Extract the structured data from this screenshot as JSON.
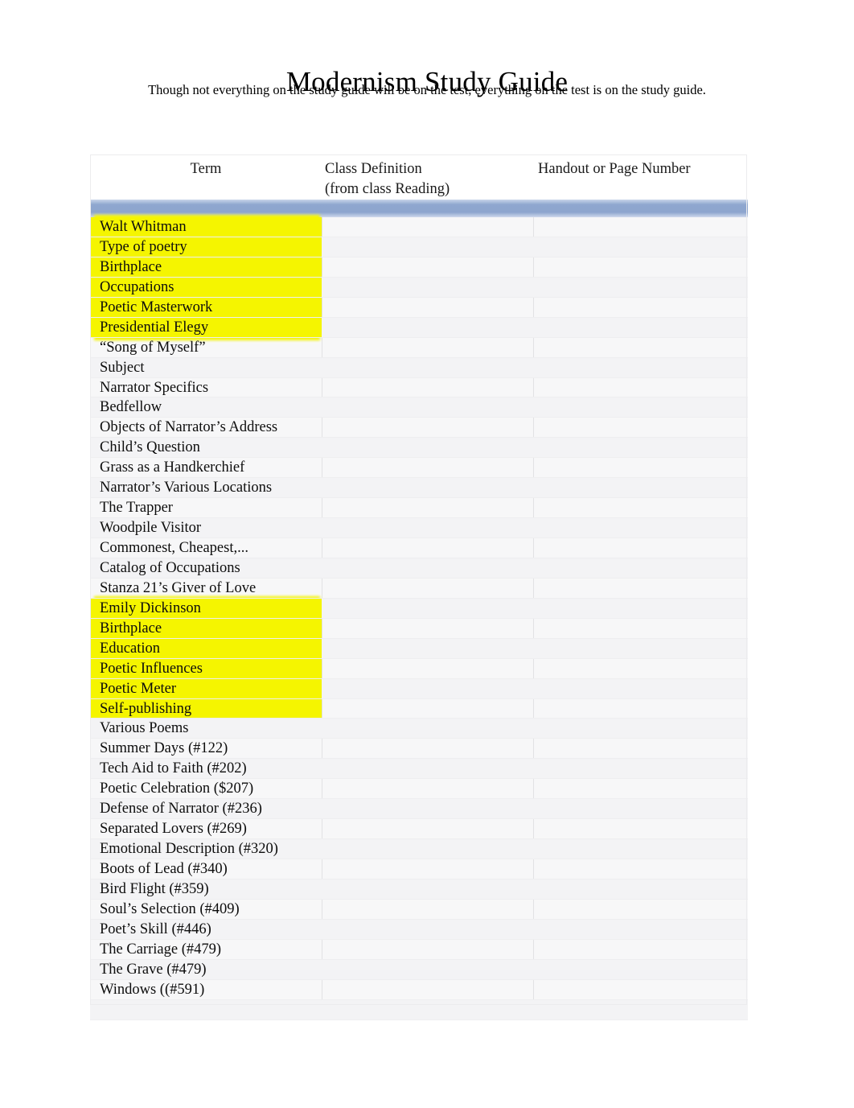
{
  "document": {
    "title": "Modernism Study Guide",
    "subtitle": "Though not everything on the study guide will be on the test, everything on the test is on the study guide."
  },
  "colors": {
    "header_band": "#8FA7CF",
    "highlight": "#F5F500",
    "table_background": "#F7F7F8",
    "text": "#000000"
  },
  "table": {
    "columns": [
      {
        "key": "term",
        "label": "Term"
      },
      {
        "key": "definition",
        "label": "Class Definition",
        "label_line2": "(from class Reading)"
      },
      {
        "key": "page",
        "label": "Handout or Page Number"
      }
    ],
    "rows": [
      {
        "term": "Walt Whitman",
        "definition": "",
        "page": "",
        "highlighted": true
      },
      {
        "term": "Type of poetry",
        "definition": "",
        "page": "",
        "highlighted": true
      },
      {
        "term": "Birthplace",
        "definition": "",
        "page": "",
        "highlighted": true
      },
      {
        "term": "Occupations",
        "definition": "",
        "page": "",
        "highlighted": true
      },
      {
        "term": "Poetic Masterwork",
        "definition": "",
        "page": "",
        "highlighted": true
      },
      {
        "term": "Presidential Elegy",
        "definition": "",
        "page": "",
        "highlighted": true
      },
      {
        "term": "“Song of Myself”",
        "definition": "",
        "page": "",
        "highlighted": false
      },
      {
        "term": "Subject",
        "definition": "",
        "page": "",
        "highlighted": false
      },
      {
        "term": "Narrator Specifics",
        "definition": "",
        "page": "",
        "highlighted": false
      },
      {
        "term": "Bedfellow",
        "definition": "",
        "page": "",
        "highlighted": false
      },
      {
        "term": "Objects of Narrator’s Address",
        "definition": "",
        "page": "",
        "highlighted": false
      },
      {
        "term": "Child’s Question",
        "definition": "",
        "page": "",
        "highlighted": false
      },
      {
        "term": "Grass as a Handkerchief",
        "definition": "",
        "page": "",
        "highlighted": false
      },
      {
        "term": "Narrator’s Various Locations",
        "definition": "",
        "page": "",
        "highlighted": false
      },
      {
        "term": "The Trapper",
        "definition": "",
        "page": "",
        "highlighted": false
      },
      {
        "term": "Woodpile Visitor",
        "definition": "",
        "page": "",
        "highlighted": false
      },
      {
        "term": "Commonest, Cheapest,...",
        "definition": "",
        "page": "",
        "highlighted": false
      },
      {
        "term": "Catalog of Occupations",
        "definition": "",
        "page": "",
        "highlighted": false
      },
      {
        "term": "Stanza 21’s Giver of Love",
        "definition": "",
        "page": "",
        "highlighted": false
      },
      {
        "term": "Emily Dickinson",
        "definition": "",
        "page": "",
        "highlighted": true
      },
      {
        "term": "Birthplace",
        "definition": "",
        "page": "",
        "highlighted": true
      },
      {
        "term": "Education",
        "definition": "",
        "page": "",
        "highlighted": true
      },
      {
        "term": "Poetic Influences",
        "definition": "",
        "page": "",
        "highlighted": true
      },
      {
        "term": "Poetic Meter",
        "definition": "",
        "page": "",
        "highlighted": true
      },
      {
        "term": "Self-publishing",
        "definition": "",
        "page": "",
        "highlighted": true
      },
      {
        "term": "Various Poems",
        "definition": "",
        "page": "",
        "highlighted": false
      },
      {
        "term": "Summer Days (#122)",
        "definition": "",
        "page": "",
        "highlighted": false
      },
      {
        "term": "Tech Aid to Faith (#202)",
        "definition": "",
        "page": "",
        "highlighted": false
      },
      {
        "term": "Poetic Celebration ($207)",
        "definition": "",
        "page": "",
        "highlighted": false
      },
      {
        "term": "Defense of Narrator (#236)",
        "definition": "",
        "page": "",
        "highlighted": false
      },
      {
        "term": "Separated Lovers (#269)",
        "definition": "",
        "page": "",
        "highlighted": false
      },
      {
        "term": "Emotional Description (#320)",
        "definition": "",
        "page": "",
        "highlighted": false
      },
      {
        "term": "Boots of Lead (#340)",
        "definition": "",
        "page": "",
        "highlighted": false
      },
      {
        "term": "Bird Flight (#359)",
        "definition": "",
        "page": "",
        "highlighted": false
      },
      {
        "term": "Soul’s Selection (#409)",
        "definition": "",
        "page": "",
        "highlighted": false
      },
      {
        "term": "Poet’s Skill (#446)",
        "definition": "",
        "page": "",
        "highlighted": false
      },
      {
        "term": "The Carriage (#479)",
        "definition": "",
        "page": "",
        "highlighted": false
      },
      {
        "term": "The Grave (#479)",
        "definition": "",
        "page": "",
        "highlighted": false
      },
      {
        "term": "Windows ((#591)",
        "definition": "",
        "page": "",
        "highlighted": false
      },
      {
        "term": "",
        "definition": "",
        "page": "",
        "highlighted": false
      }
    ]
  }
}
